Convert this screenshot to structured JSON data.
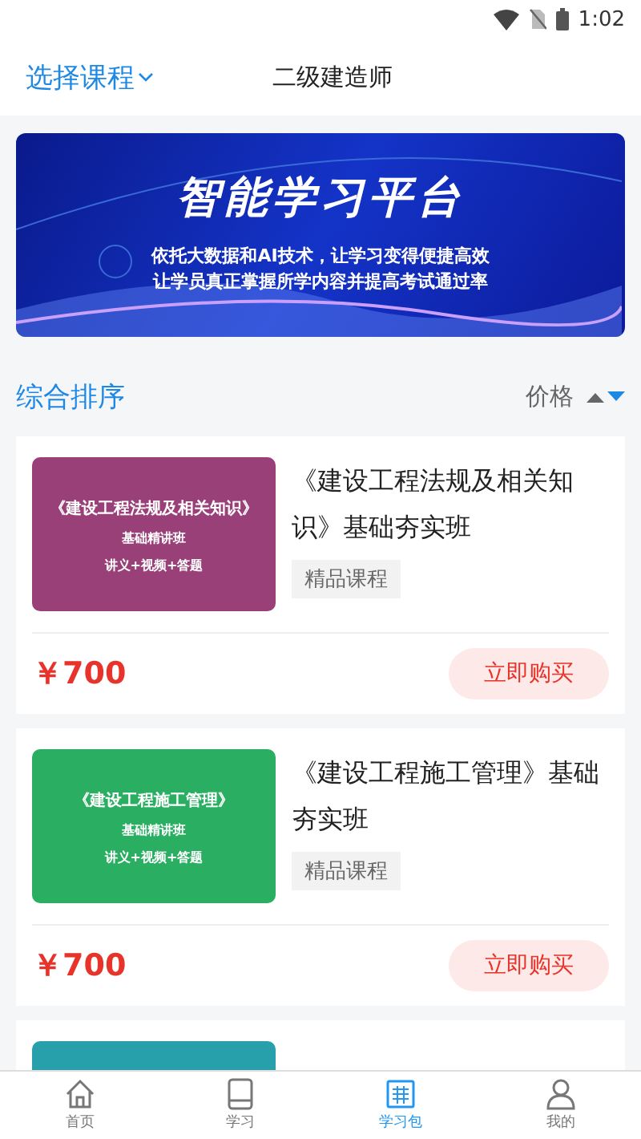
{
  "status_bar": {
    "time": "1:02"
  },
  "header": {
    "course_picker": "选择课程",
    "title": "二级建造师"
  },
  "banner": {
    "headline": "智能学习平台",
    "lines": [
      "依托大数据和AI技术，让学习变得便捷高效",
      "让学员真正掌握所学内容并提高考试通过率"
    ]
  },
  "sort_bar": {
    "label": "综合排序",
    "price_label": "价格",
    "descending": true
  },
  "courses": [
    {
      "title": "《建设工程法规及相关知识》基础夯实班",
      "tag": "精品课程",
      "price": "￥700",
      "buy": "立即购买",
      "cover": {
        "color": "#9a4078",
        "title": "《建设工程法规及相关知识》",
        "subtitle": "基础精讲班",
        "features": "讲义+视频+答题"
      }
    },
    {
      "title": "《建设工程施工管理》基础夯实班",
      "tag": "精品课程",
      "price": "￥700",
      "buy": "立即购买",
      "cover": {
        "color": "#2aae62",
        "title": "《建设工程施工管理》",
        "subtitle": "基础精讲班",
        "features": "讲义+视频+答题"
      }
    },
    {
      "cover": {
        "color": "#27a0ac"
      }
    }
  ],
  "tab_bar": [
    {
      "label": "首页",
      "selected": false
    },
    {
      "label": "学习",
      "selected": false
    },
    {
      "label": "学习包",
      "selected": true
    },
    {
      "label": "我的",
      "selected": false
    }
  ]
}
